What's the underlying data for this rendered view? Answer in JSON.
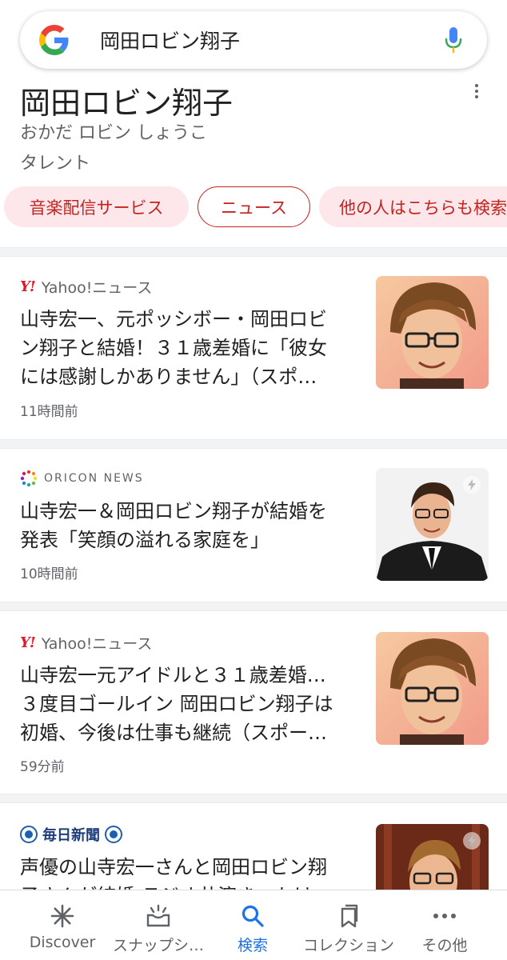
{
  "search": {
    "query": "岡田ロビン翔子"
  },
  "entity": {
    "title": "岡田ロビン翔子",
    "reading": "おかだ ロビン しょうこ",
    "type": "タレント"
  },
  "chips": [
    "音楽配信サービス",
    "ニュース",
    "他の人はこちらも検索"
  ],
  "news": [
    {
      "source": "Yahoo!ニュース",
      "source_logo": "Y!",
      "headline_lines": [
        "山寺宏一、元ポッシボー・岡田ロビ",
        "ン翔子と結婚！３１歳差婚に「彼女",
        "には感謝しかありません」（スポ…"
      ],
      "time": "11時間前"
    },
    {
      "source": "ORICON NEWS",
      "headline_lines": [
        "山寺宏一＆岡田ロビン翔子が結婚を",
        "発表「笑顔の溢れる家庭を」"
      ],
      "time": "10時間前"
    },
    {
      "source": "Yahoo!ニュース",
      "source_logo": "Y!",
      "headline_lines": [
        "山寺宏一元アイドルと３１歳差婚…",
        "３度目ゴールイン 岡田ロビン翔子は",
        "初婚、今後は仕事も継続（スポー…"
      ],
      "time": "59分前"
    },
    {
      "source": "毎日新聞",
      "headline_lines": [
        "声優の山寺宏一さんと岡田ロビン翔",
        "子さんが結婚 ラジオ共演きっかけ"
      ]
    }
  ],
  "bottom_nav": [
    {
      "label": "Discover",
      "icon": "asterisk-icon"
    },
    {
      "label": "スナップシ…",
      "icon": "snapshot-icon"
    },
    {
      "label": "検索",
      "icon": "search-icon",
      "active": true
    },
    {
      "label": "コレクション",
      "icon": "collections-icon"
    },
    {
      "label": "その他",
      "icon": "more-horiz-icon"
    }
  ],
  "colors": {
    "chip_bg": "#fde7ea",
    "chip_text": "#c5221f",
    "active_blue": "#1a73e8",
    "yahoo_red": "#e01a2b"
  }
}
